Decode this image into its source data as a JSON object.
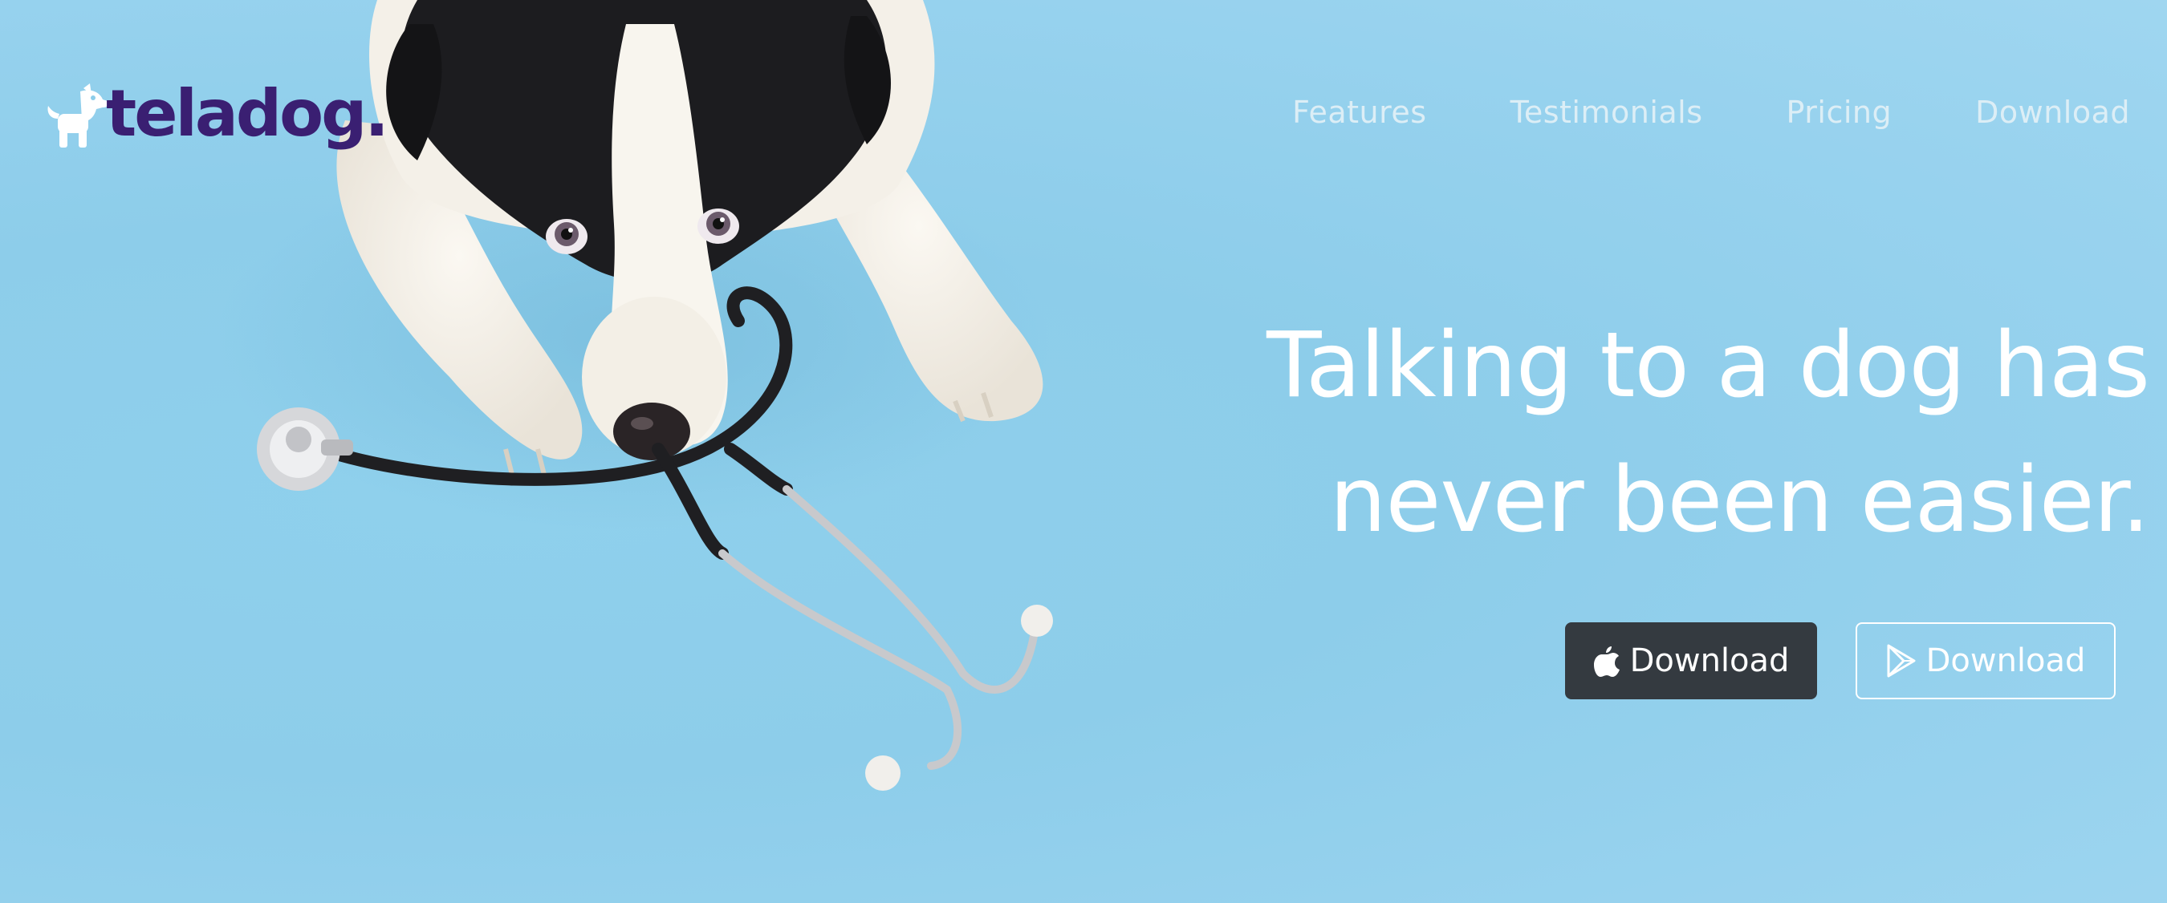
{
  "brand": {
    "name": "teladog.",
    "logo_icon": "dog-icon",
    "color": "#3a1f72"
  },
  "nav": {
    "items": [
      {
        "label": "Features"
      },
      {
        "label": "Testimonials"
      },
      {
        "label": "Pricing"
      },
      {
        "label": "Download"
      }
    ]
  },
  "hero": {
    "headline_line1": "Talking to a dog has",
    "headline_line2": "never been easier.",
    "background_color": "#8dcdea",
    "image": "dog-with-stethoscope"
  },
  "buttons": {
    "apple": {
      "label": "Download",
      "icon": "apple-icon",
      "color": "#343a40"
    },
    "google": {
      "label": "Download",
      "icon": "google-play-icon"
    }
  }
}
